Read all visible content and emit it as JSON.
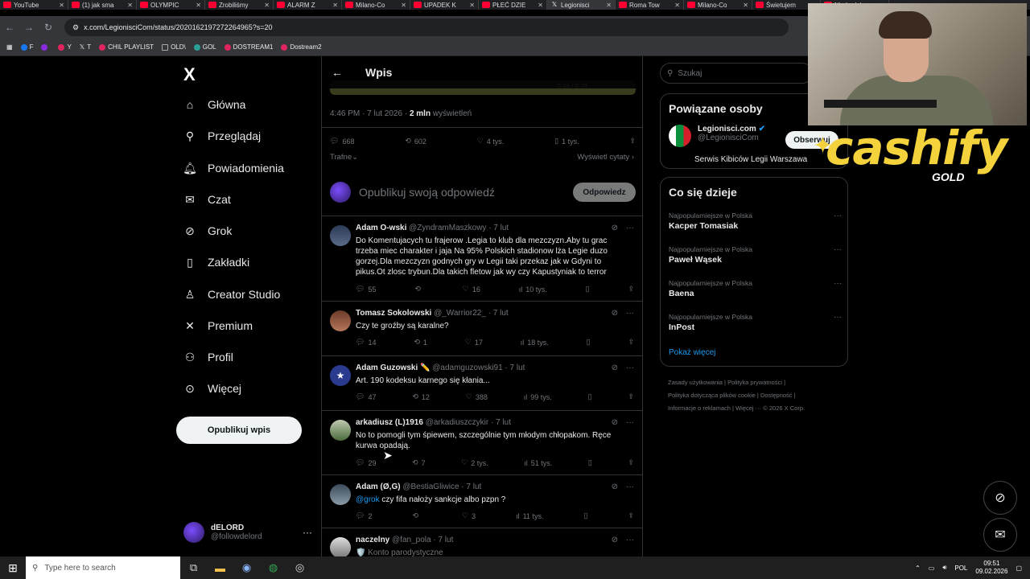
{
  "browser": {
    "tabs": [
      {
        "label": "YouTube"
      },
      {
        "label": "(1) jak sma"
      },
      {
        "label": "OLYMPIC"
      },
      {
        "label": "Zrobiliśmy"
      },
      {
        "label": "ALARM Z"
      },
      {
        "label": "Milano-Co"
      },
      {
        "label": "UPADEK K"
      },
      {
        "label": "PŁEĆ DZIE"
      },
      {
        "label": "Legionisci"
      },
      {
        "label": "Roma Tow"
      },
      {
        "label": "Milano-Co"
      },
      {
        "label": "Świetujem"
      },
      {
        "label": "Nie będzi"
      }
    ],
    "url": "x.com/LegionisciCom/status/2020162197272264965?s=20",
    "bookmarks": [
      {
        "label": "F"
      },
      {
        "label": ""
      },
      {
        "label": "Y"
      },
      {
        "label": "T"
      },
      {
        "label": "CHIL PLAYLIST"
      },
      {
        "label": "OLD\\"
      },
      {
        "label": "GOL"
      },
      {
        "label": "DOSTREAM1"
      },
      {
        "label": "Dostream2"
      }
    ]
  },
  "leftnav": {
    "logo": "X",
    "items": [
      {
        "label": "Główna",
        "icon": "home-icon"
      },
      {
        "label": "Przeglądaj",
        "icon": "search-icon"
      },
      {
        "label": "Powiadomienia",
        "icon": "bell-icon"
      },
      {
        "label": "Czat",
        "icon": "mail-icon"
      },
      {
        "label": "Grok",
        "icon": "grok-icon"
      },
      {
        "label": "Zakładki",
        "icon": "bookmark-icon"
      },
      {
        "label": "Creator Studio",
        "icon": "creator-icon"
      },
      {
        "label": "Premium",
        "icon": "x-icon"
      },
      {
        "label": "Profil",
        "icon": "person-icon"
      },
      {
        "label": "Więcej",
        "icon": "more-icon"
      }
    ],
    "post_button": "Opublikuj wpis",
    "profile": {
      "name": "dELORD",
      "handle": "@followdelord"
    }
  },
  "main": {
    "header_title": "Wpis",
    "video_time": "0:34 / 0:38",
    "meta_time": "4:46 PM · 7 lut 2026 · ",
    "meta_views": "2 mln",
    "meta_views_suffix": " wyświetleń",
    "actions": {
      "replies": "668",
      "reposts": "602",
      "likes": "4 tys.",
      "bookmarks": "1 tys."
    },
    "sort_label": "Trafne",
    "quotes_label": "Wyświetl cytaty",
    "reply_placeholder": "Opublikuj swoją odpowiedź",
    "reply_button": "Odpowiedz",
    "tweets": [
      {
        "name": "Adam O-wski",
        "handle": "@ZyndramMaszkowy",
        "time": "· 7 lut",
        "text": "Do Komentujacych tu frajerow .Legia to klub dla mezczyzn.Aby tu grac trzeba miec charakter i jaja Na 95% Polskich stadionow lża Legie duzo gorzej.Dla mezczyzn godnych gry w Legii taki przekaz jak w Gdyni to pikus.Ot zlosc trybun.Dla takich fletow jak wy czy Kapustyniak to terror",
        "replies": "55",
        "reposts": "",
        "likes": "16",
        "views": "10 tys."
      },
      {
        "name": "Tomasz Sokolowski",
        "handle": "@_Warrior22_",
        "time": "· 7 lut",
        "text": "Czy te groźby są karalne?",
        "replies": "14",
        "reposts": "1",
        "likes": "17",
        "views": "18 tys."
      },
      {
        "name": "Adam Guzowski ✏️",
        "handle": "@adamguzowski91",
        "time": "· 7 lut",
        "text": "Art. 190 kodeksu karnego się kłania...",
        "replies": "47",
        "reposts": "12",
        "likes": "388",
        "views": "99 tys."
      },
      {
        "name": "arkadiusz (L)1916",
        "handle": "@arkadiuszczykir",
        "time": "· 7 lut",
        "text": "No to pomogli tym śpiewem, szczególnie tym młodym chłopakom. Ręce kurwa opadają.",
        "replies": "29",
        "reposts": "7",
        "likes": "2 tys.",
        "views": "51 tys."
      },
      {
        "name": "Adam (Ø,G)",
        "handle": "@BestiaGliwice",
        "time": "· 7 lut",
        "mention": "@grok",
        "text": " czy fifa nałoży sankcje albo pzpn ?",
        "replies": "2",
        "reposts": "",
        "likes": "3",
        "views": "11 tys."
      },
      {
        "name": "naczelny",
        "handle": "@fan_pola",
        "time": "· 7 lut",
        "text": "🛡️ Konto parodystyczne",
        "replies": "",
        "reposts": "",
        "likes": "",
        "views": ""
      }
    ]
  },
  "right": {
    "search_placeholder": "Szukaj",
    "related_title": "Powiązane osoby",
    "related": {
      "name": "Legionisci.com",
      "handle": "@LegionisciCom",
      "desc": "Serwis Kibiców Legii Warszawa",
      "follow": "Obserwuj"
    },
    "trends_title": "Co się dzieje",
    "trends": [
      {
        "category": "Najpopularniejsze w Polska",
        "name": "Kacper Tomasiak"
      },
      {
        "category": "Najpopularniejsze w Polska",
        "name": "Paweł Wąsek"
      },
      {
        "category": "Najpopularniejsze w Polska",
        "name": "Baena"
      },
      {
        "category": "Najpopularniejsze w Polska",
        "name": "InPost"
      }
    ],
    "show_more": "Pokaż więcej",
    "footer": [
      "Zasady użytkowania",
      "Polityka prywatności",
      "Polityka dotycząca plików cookie",
      "Dostępność",
      "Informacje o reklamach",
      "Więcej ···",
      "© 2026 X Corp."
    ]
  },
  "overlay": {
    "brand": "cashify",
    "brand_sub": "GOLD"
  },
  "taskbar": {
    "search_placeholder": "Type here to search",
    "lang": "POL",
    "time": "09:51",
    "date": "09.02.2026"
  }
}
